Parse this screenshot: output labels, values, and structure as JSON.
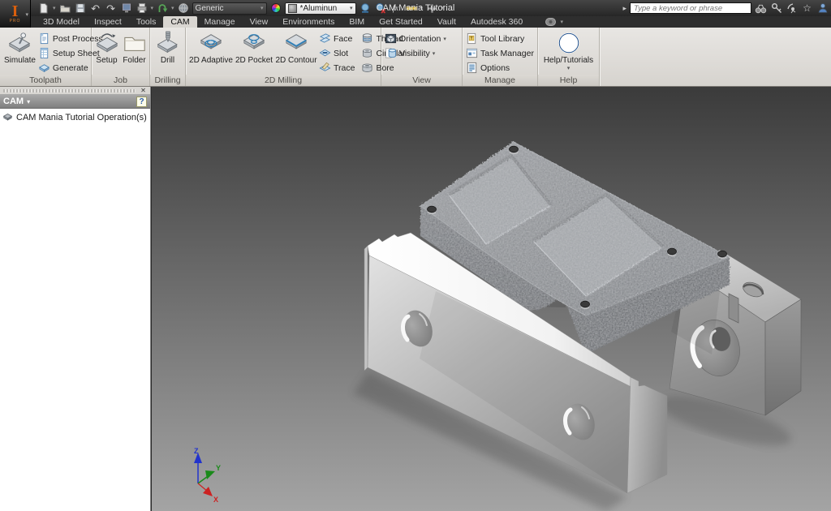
{
  "window": {
    "title": "CAM Mania Tutorial"
  },
  "qat": {
    "icons": [
      "inventor-logo",
      "new-file",
      "open-file",
      "save",
      "undo",
      "redo",
      "local-update",
      "print",
      "return",
      "web-browser",
      "color-wheel",
      "adjust-appearance",
      "clear-appearance",
      "parameters-fx",
      "measure",
      "join",
      "customize-toolbar"
    ],
    "material": "Generic",
    "appearance": "*Aluminun"
  },
  "search": {
    "placeholder": "Type a keyword or phrase"
  },
  "title_icons": [
    "search",
    "subscription",
    "communication-center",
    "favorites",
    "sign-in"
  ],
  "tabs": {
    "items": [
      "3D Model",
      "Inspect",
      "Tools",
      "CAM",
      "Manage",
      "View",
      "Environments",
      "BIM",
      "Get Started",
      "Vault",
      "Autodesk 360"
    ],
    "active": "CAM"
  },
  "ribbon": {
    "panels": {
      "toolpath": {
        "label": "Toolpath",
        "simulate": "Simulate",
        "items": [
          "Post Process",
          "Setup Sheet",
          "Generate"
        ]
      },
      "job": {
        "label": "Job",
        "setup": "Setup",
        "folder": "Folder"
      },
      "drilling": {
        "label": "Drilling",
        "drill": "Drill"
      },
      "milling": {
        "label": "2D Milling",
        "big": [
          "2D Adaptive",
          "2D Pocket",
          "2D Contour"
        ],
        "small": [
          "Face",
          "Slot",
          "Trace",
          "Thread",
          "Circular",
          "Bore"
        ]
      },
      "view": {
        "label": "View",
        "items": [
          "Orientation",
          "Visibility"
        ]
      },
      "manage": {
        "label": "Manage",
        "items": [
          "Tool Library",
          "Task Manager",
          "Options"
        ]
      },
      "help": {
        "label": "Help",
        "button": "Help/Tutorials"
      }
    }
  },
  "browser": {
    "title": "CAM",
    "help_badge": "?",
    "tree_item": "CAM Mania Tutorial Operation(s)"
  },
  "viewport": {
    "axes": {
      "x": "X",
      "y": "Y",
      "z": "Z"
    }
  },
  "colors": {
    "viewport_top": "#3b3b3b",
    "viewport_bottom": "#a4a4a4",
    "axis_x": "#cc2222",
    "axis_y": "#1a8a1a",
    "axis_z": "#2233cc",
    "accent_blue": "#4a80b0",
    "logo_orange": "#d95f0d"
  }
}
